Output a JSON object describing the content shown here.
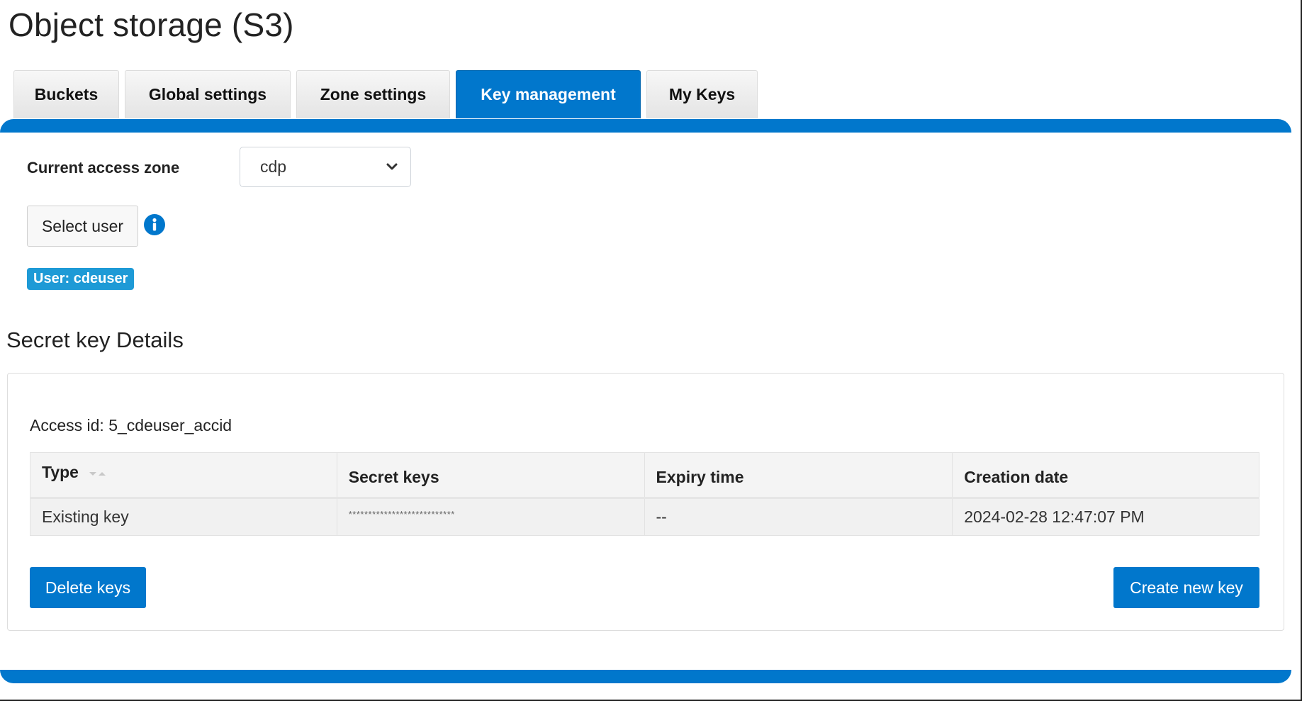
{
  "page": {
    "title": "Object storage (S3)"
  },
  "tabs": [
    {
      "label": "Buckets",
      "active": false
    },
    {
      "label": "Global settings",
      "active": false
    },
    {
      "label": "Zone settings",
      "active": false
    },
    {
      "label": "Key management",
      "active": true
    },
    {
      "label": "My Keys",
      "active": false
    }
  ],
  "zone": {
    "label": "Current access zone",
    "selected": "cdp"
  },
  "user": {
    "select_button": "Select user",
    "info_icon": "info-circle-icon",
    "badge": "User: cdeuser"
  },
  "secret_keys": {
    "section_title": "Secret key Details",
    "access_id": "Access id: 5_cdeuser_accid",
    "columns": [
      "Type",
      "Secret keys",
      "Expiry time",
      "Creation date"
    ],
    "sort_icon": "sort-icon",
    "rows": [
      {
        "type": "Existing key",
        "secret": "***************************",
        "expiry": "--",
        "created": "2024-02-28 12:47:07 PM"
      }
    ],
    "delete_button": "Delete keys",
    "create_button": "Create new key"
  },
  "colors": {
    "accent": "#0177cc",
    "badge": "#1e9ad6"
  }
}
